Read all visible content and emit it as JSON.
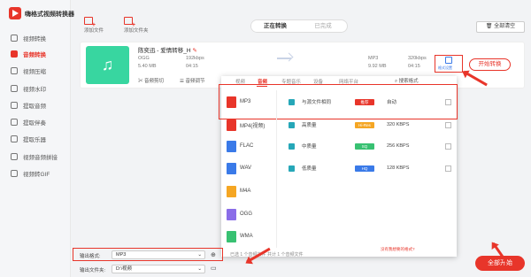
{
  "app": {
    "title": "嗨格式视频转换器"
  },
  "sidebar": {
    "items": [
      {
        "label": "视频转换"
      },
      {
        "label": "音频转换"
      },
      {
        "label": "视频压缩"
      },
      {
        "label": "视频水印"
      },
      {
        "label": "提取音频"
      },
      {
        "label": "提取伴奏"
      },
      {
        "label": "提取乐器"
      },
      {
        "label": "视频音频拼接"
      },
      {
        "label": "视频转GIF"
      }
    ]
  },
  "toolbar": {
    "add_file": "添加文件",
    "add_folder": "添加文件夹",
    "clear_all": "全部清空"
  },
  "tabs": {
    "converting": "正在转换",
    "done": "已完成"
  },
  "file": {
    "name": "陈奕迅 - 爱情转移_H",
    "src_format": "OGG",
    "src_size": "5.40 MB",
    "src_bitrate": "192kbps",
    "src_duration": "04:15",
    "dst_format": "MP3",
    "dst_size": "9.92 MB",
    "dst_bitrate": "320kbps",
    "dst_duration": "04:15",
    "settings_label": "格式设置",
    "start_label": "开始转换",
    "cut_label": "音频剪切",
    "adjust_label": "音频调节"
  },
  "panel": {
    "tabs": [
      "视频",
      "音频",
      "专题音乐",
      "设备",
      "网络平台"
    ],
    "search": "搜索格式",
    "formats": [
      {
        "label": "MP3",
        "color": "#e8352a"
      },
      {
        "label": "MP4(视频)",
        "color": "#e8352a"
      },
      {
        "label": "FLAC",
        "color": "#3a7ae8"
      },
      {
        "label": "WAV",
        "color": "#3a7ae8"
      },
      {
        "label": "M4A",
        "color": "#f5a623"
      },
      {
        "label": "OGG",
        "color": "#8a6de8"
      },
      {
        "label": "WMA",
        "color": "#38c172"
      }
    ],
    "qualities": [
      {
        "name": "与源文件相同",
        "tag": "推荐",
        "tag_color": "#e8352a",
        "value": "自动"
      },
      {
        "name": "高质量",
        "tag": "Hi-Res",
        "tag_color": "#f5a623",
        "value": "320 KBPS"
      },
      {
        "name": "中质量",
        "tag": "SQ",
        "tag_color": "#38c172",
        "value": "256 KBPS"
      },
      {
        "name": "低质量",
        "tag": "HQ",
        "tag_color": "#3a7ae8",
        "value": "128 KBPS"
      }
    ],
    "hint": "没有我想要的格式?"
  },
  "bottom": {
    "output_format_label": "输出格式:",
    "output_format_value": "MP3",
    "output_folder_label": "输出文件夹:",
    "output_folder_value": "D:\\视频",
    "file_count": "已选 1 个音频文件 共计 1 个音频文件",
    "start_all": "全部开始"
  }
}
